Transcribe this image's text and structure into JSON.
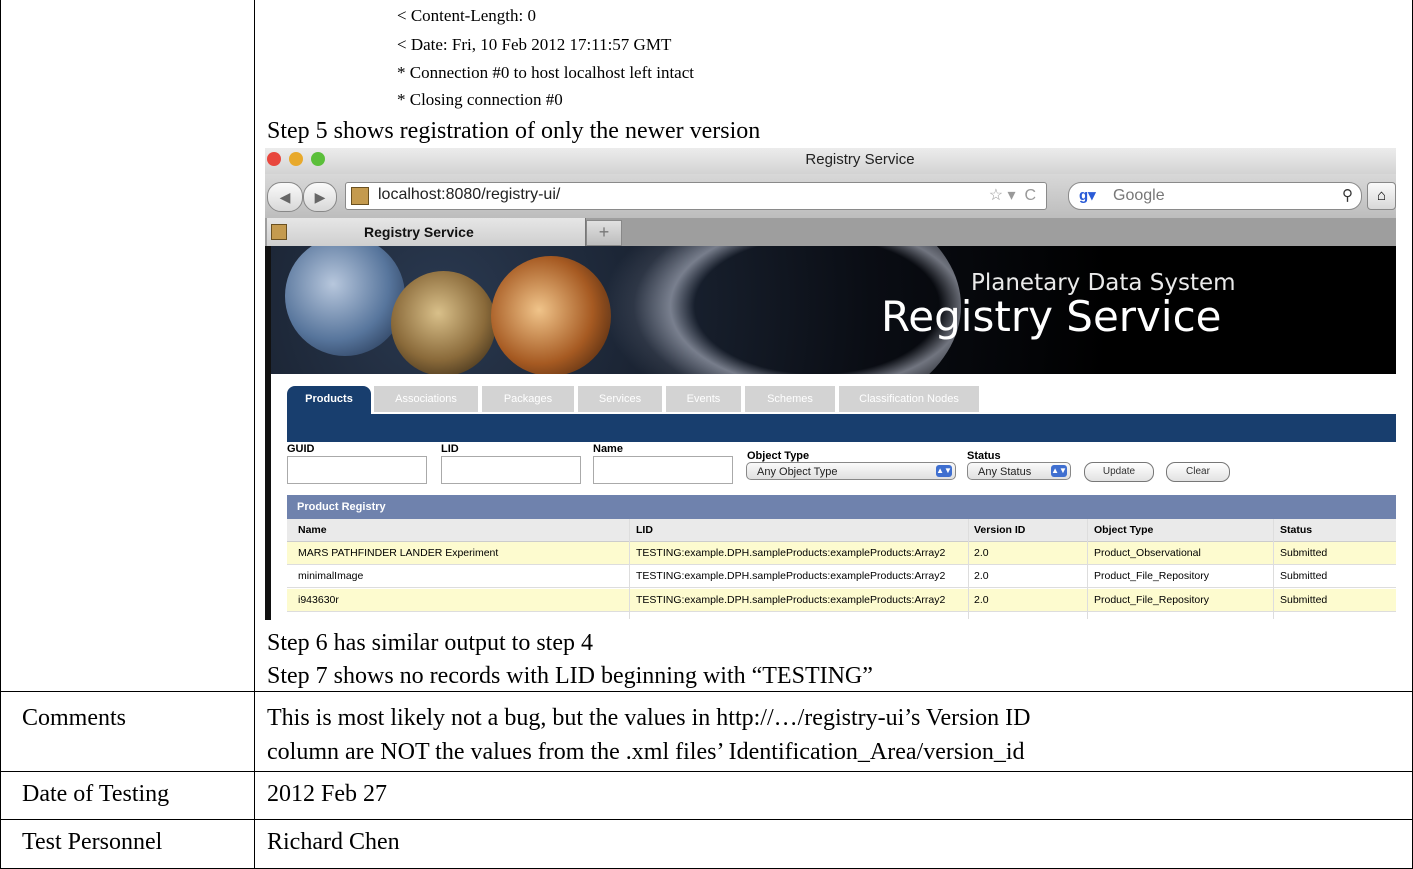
{
  "doc": {
    "log_lines": [
      "< Content-Length: 0",
      "< Date: Fri, 10 Feb 2012 17:11:57 GMT",
      "* Connection #0 to host localhost left intact",
      "* Closing connection #0"
    ],
    "step5": "Step 5 shows registration of only the newer version",
    "step6": "Step 6 has similar output to step 4",
    "step7": "Step 7 shows no records with LID beginning with “TESTING”",
    "comments_label": "Comments",
    "comments_line1": "This is most likely not a bug, but the values in http://…/registry-ui’s Version ID",
    "comments_line2": "column are NOT the values from the .xml files’ Identification_Area/version_id",
    "date_label": "Date of Testing",
    "date_value": "2012 Feb 27",
    "personnel_label": "Test Personnel",
    "personnel_value": "Richard Chen"
  },
  "browser": {
    "window_title": "Registry Service",
    "url": "localhost:8080/registry-ui/",
    "search_placeholder": "Google",
    "tab_title": "Registry Service",
    "new_tab": "+",
    "back": "◀",
    "forward": "▶",
    "reload": "C",
    "home": "⌂",
    "search_icon": "⚲",
    "star": "☆ ▾",
    "colors": {
      "navy": "#183e6e",
      "header": "#6f82ad",
      "row_highlight": "#fdfbcf"
    }
  },
  "app": {
    "banner_line1": "Planetary Data System",
    "banner_line2": "Registry Service",
    "tabs": [
      "Products",
      "Associations",
      "Packages",
      "Services",
      "Events",
      "Schemes",
      "Classification Nodes"
    ],
    "filters": {
      "guid_label": "GUID",
      "lid_label": "LID",
      "name_label": "Name",
      "object_type_label": "Object Type",
      "object_type_value": "Any Object Type",
      "status_label": "Status",
      "status_value": "Any Status",
      "update_button": "Update",
      "clear_button": "Clear"
    },
    "registry": {
      "title": "Product Registry",
      "columns": [
        "Name",
        "LID",
        "Version ID",
        "Object Type",
        "Status"
      ],
      "rows": [
        [
          "MARS PATHFINDER LANDER Experiment",
          "TESTING:example.DPH.sampleProducts:exampleProducts:Array2",
          "2.0",
          "Product_Observational",
          "Submitted"
        ],
        [
          "minimalImage",
          "TESTING:example.DPH.sampleProducts:exampleProducts:Array2",
          "2.0",
          "Product_File_Repository",
          "Submitted"
        ],
        [
          "i943630r",
          "TESTING:example.DPH.sampleProducts:exampleProducts:Array2",
          "2.0",
          "Product_File_Repository",
          "Submitted"
        ]
      ]
    }
  }
}
